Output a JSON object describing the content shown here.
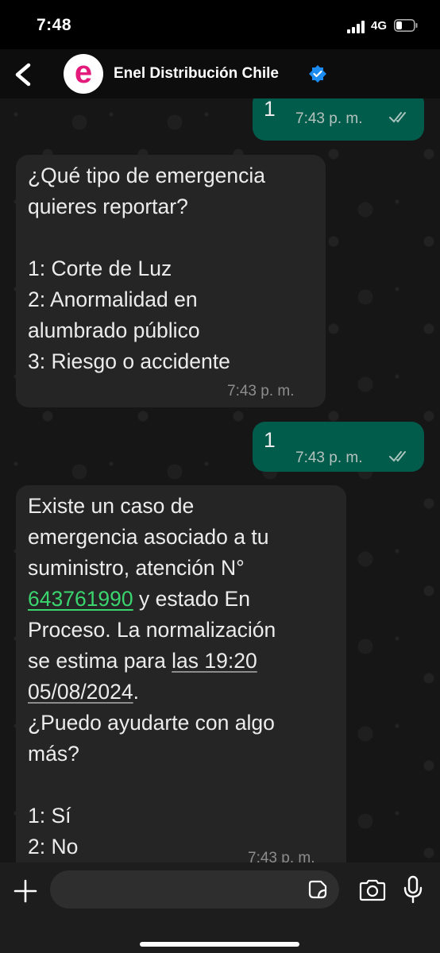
{
  "status_bar": {
    "time": "7:48",
    "network": "4G"
  },
  "header": {
    "contact_name": "Enel Distribución Chile",
    "avatar_letter": "e"
  },
  "messages": [
    {
      "direction": "outgoing",
      "text": "1",
      "time": "7:43 p. m."
    },
    {
      "direction": "incoming",
      "lines": [
        "¿Qué tipo de emergencia",
        "quieres reportar?",
        "",
        "1: Corte de Luz",
        "2: Anormalidad en",
        "alumbrado público",
        "3: Riesgo o accidente"
      ],
      "time": "7:43 p. m."
    },
    {
      "direction": "outgoing",
      "text": "1",
      "time": "7:43 p. m."
    },
    {
      "direction": "incoming",
      "lines": [
        "Existe un caso de",
        "emergencia asociado a tu",
        "suministro, atención N°"
      ],
      "case_number": "643761990",
      "after_case": " y estado En",
      "line5": "Proceso. La normalización",
      "line6_prefix": "se estima para ",
      "line6_date": "las 19:20",
      "line7_date": "05/08/2024",
      "line7_suffix": ".",
      "lines_after": [
        "¿Puedo ayudarte con algo",
        "más?",
        "",
        "1: Sí",
        "2: No"
      ],
      "time": "7:43 p. m."
    }
  ],
  "icons": {
    "back": "chevron-left-icon",
    "verified": "verified-badge-icon",
    "plus": "plus-icon",
    "sticker": "sticker-icon",
    "camera": "camera-icon",
    "mic": "microphone-icon"
  },
  "colors": {
    "outgoing_bubble": "#025c4c",
    "incoming_bubble": "#252525",
    "link": "#3bd56f",
    "brand": "#e3197c",
    "read_ticks": "#a9c4bd"
  }
}
